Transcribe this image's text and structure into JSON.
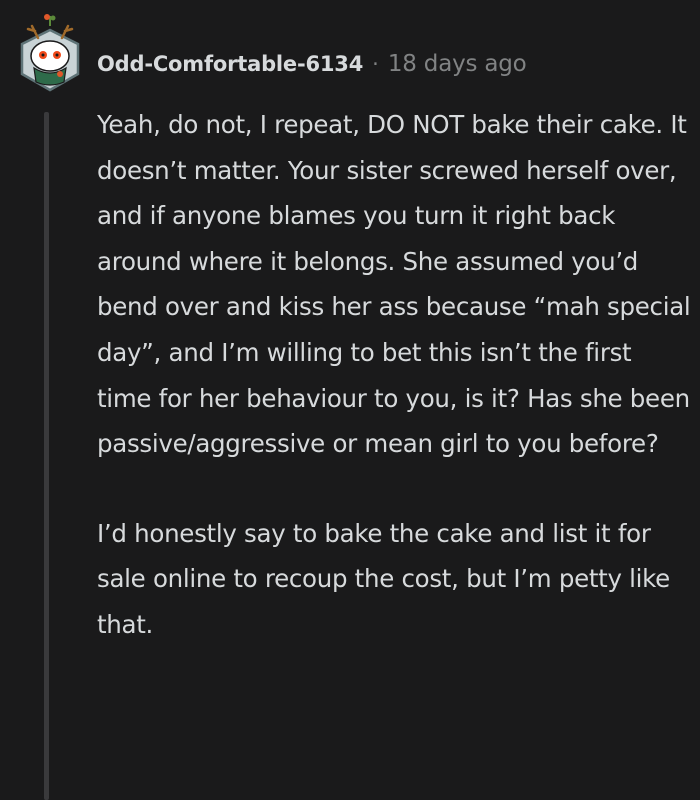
{
  "comment": {
    "author": "Odd-Comfortable-6134",
    "separator": "·",
    "timestamp": "18 days ago",
    "avatar_icon": "snoo-avatar-icon",
    "paragraphs": [
      "Yeah, do not, I repeat, DO NOT bake their cake. It doesn’t matter. Your sister screwed herself over, and if anyone blames you turn it right back around where it belongs. She assumed you’d bend over and kiss her ass because “mah special day”, and I’m willing to bet this isn’t the first time for her behaviour to you, is it? Has she been passive/aggressive or mean girl to you before?",
      "I’d honestly say to bake the cake and list it for sale online to recoup the cost, but I’m petty like that."
    ]
  },
  "colors": {
    "background": "#1a1a1b",
    "text": "#d7dadc",
    "meta": "#818384",
    "thread_line": "#3a3a3c"
  }
}
